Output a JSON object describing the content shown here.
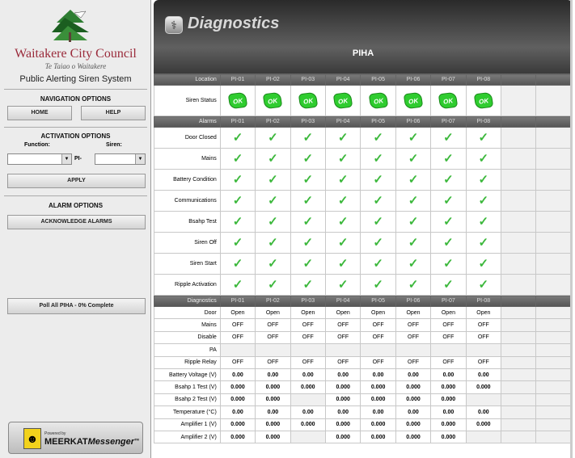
{
  "sidebar": {
    "council_name": "Waitakere City Council",
    "council_maori": "Te Taiao o Waitakere",
    "system_name": "Public Alerting Siren System",
    "navigation": {
      "heading": "NAVIGATION OPTIONS",
      "home": "HOME",
      "help": "HELP"
    },
    "activation": {
      "heading": "ACTIVATION OPTIONS",
      "function_label": "Function:",
      "siren_label": "Siren:",
      "prefix": "PI-",
      "apply": "APPLY"
    },
    "alarm": {
      "heading": "ALARM OPTIONS",
      "acknowledge": "ACKNOWLEDGE ALARMS"
    },
    "poll": "Poll All PIHA - 0% Complete",
    "meerkat": {
      "powered": "Powered by",
      "brand1": "MEERKAT",
      "brand2": "Messenger",
      "tm": "TM"
    }
  },
  "header": {
    "title": "Diagnostics",
    "subtitle": "PIHA"
  },
  "table": {
    "location_label": "Location",
    "alarms_label": "Alarms",
    "diagnostics_label": "Diagnostics",
    "sirens": [
      "PI-01",
      "PI-02",
      "PI-03",
      "PI-04",
      "PI-05",
      "PI-06",
      "PI-07",
      "PI-08"
    ],
    "status_label": "Siren Status",
    "status_value": "OK",
    "check_glyph": "✓",
    "alarm_rows": [
      "Door Closed",
      "Mains",
      "Battery Condition",
      "Communications",
      "Bsahp Test",
      "Siren Off",
      "Siren Start",
      "Ripple Activation"
    ],
    "diag_rows": [
      {
        "label": "Door",
        "values": [
          "Open",
          "Open",
          "Open",
          "Open",
          "Open",
          "Open",
          "Open",
          "Open"
        ]
      },
      {
        "label": "Mains",
        "values": [
          "OFF",
          "OFF",
          "OFF",
          "OFF",
          "OFF",
          "OFF",
          "OFF",
          "OFF"
        ]
      },
      {
        "label": "Disable",
        "values": [
          "OFF",
          "OFF",
          "OFF",
          "OFF",
          "OFF",
          "OFF",
          "OFF",
          "OFF"
        ]
      },
      {
        "label": "PA",
        "values": [
          "",
          "",
          "",
          "",
          "",
          "",
          "",
          ""
        ]
      },
      {
        "label": "Ripple Relay",
        "values": [
          "OFF",
          "OFF",
          "OFF",
          "OFF",
          "OFF",
          "OFF",
          "OFF",
          "OFF"
        ]
      },
      {
        "label": "Battery Voltage (V)",
        "values": [
          "0.00",
          "0.00",
          "0.00",
          "0.00",
          "0.00",
          "0.00",
          "0.00",
          "0.00"
        ]
      },
      {
        "label": "Bsahp 1 Test (V)",
        "values": [
          "0.000",
          "0.000",
          "0.000",
          "0.000",
          "0.000",
          "0.000",
          "0.000",
          "0.000"
        ]
      },
      {
        "label": "Bsahp 2 Test (V)",
        "values": [
          "0.000",
          "0.000",
          "",
          "0.000",
          "0.000",
          "0.000",
          "0.000",
          ""
        ]
      },
      {
        "label": "Temperature (°C)",
        "values": [
          "0.00",
          "0.00",
          "0.00",
          "0.00",
          "0.00",
          "0.00",
          "0.00",
          "0.00"
        ]
      },
      {
        "label": "Amplifier 1 (V)",
        "values": [
          "0.000",
          "0.000",
          "0.000",
          "0.000",
          "0.000",
          "0.000",
          "0.000",
          "0.000"
        ]
      },
      {
        "label": "Amplifier 2 (V)",
        "values": [
          "0.000",
          "0.000",
          "",
          "0.000",
          "0.000",
          "0.000",
          "0.000",
          ""
        ]
      }
    ]
  }
}
